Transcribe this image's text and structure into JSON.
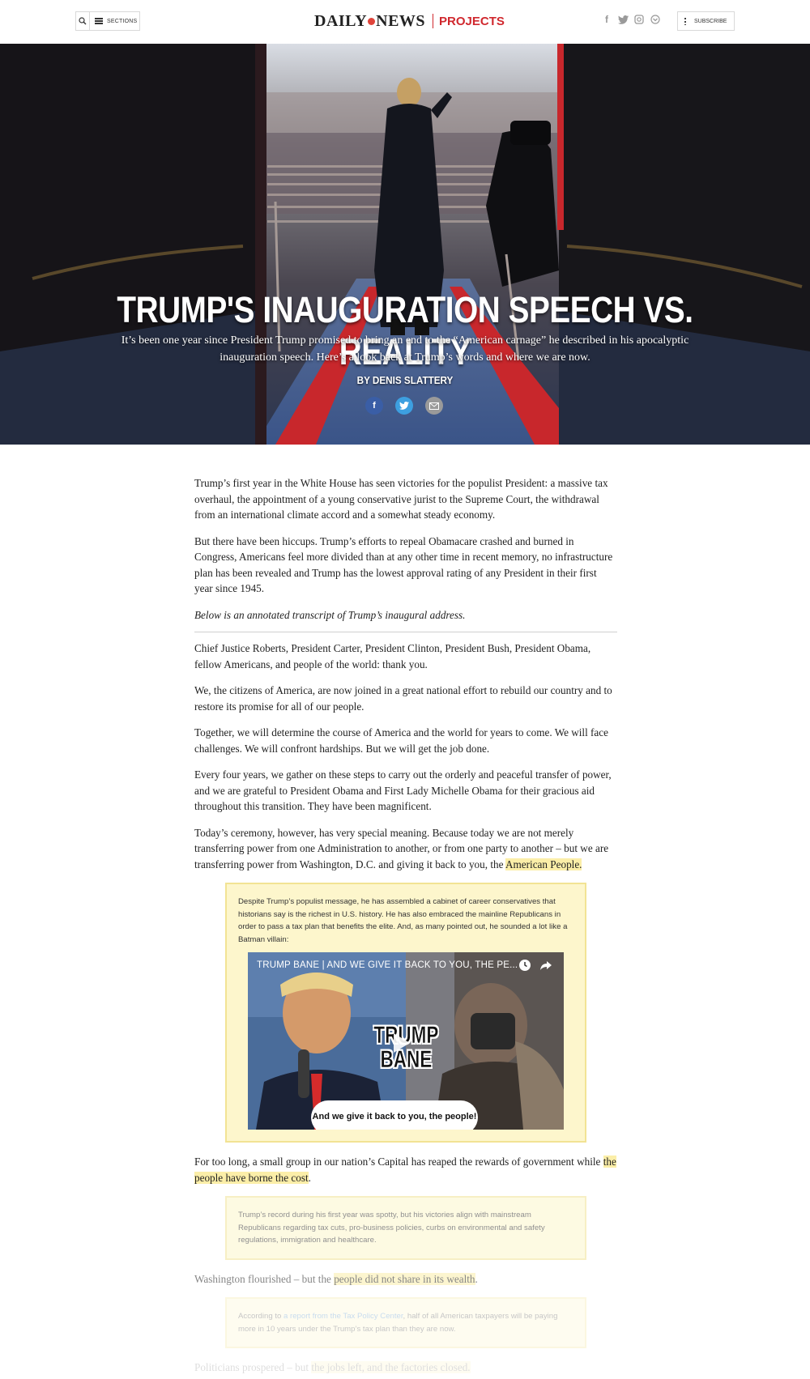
{
  "header": {
    "sections_label": "SECTIONS",
    "logo_left": "DAILY",
    "logo_right": "NEWS",
    "logo_projects": "PROJECTS",
    "subscribe_label": "SUBSCRIBE",
    "social": [
      "facebook-icon",
      "twitter-icon",
      "instagram-icon",
      "pocket-icon"
    ]
  },
  "hero": {
    "title": "TRUMP'S INAUGURATION SPEECH VS. REALITY",
    "subtitle": "It’s been one year since President Trump promised to bring an end to the “American carnage” he described in his apocalyptic inauguration speech. Here’s a look back at Trump’s words and where we are now.",
    "byline": "BY DENIS SLATTERY",
    "share": [
      "facebook-icon",
      "twitter-icon",
      "email-icon"
    ]
  },
  "article": {
    "intro": [
      "Trump’s first year in the White House has seen victories for the populist President: a massive tax overhaul, the appointment of a young conservative jurist to the Supreme Court, the withdrawal from an international climate accord and a somewhat steady economy.",
      "But there have been hiccups. Trump’s efforts to repeal Obamacare crashed and burned in Congress, Americans feel more divided than at any other time in recent memory, no infrastructure plan has been revealed and Trump has the lowest approval rating of any President in their first year since 1945."
    ],
    "transcript_note": "Below is an annotated transcript of Trump’s inaugural address.",
    "speech": [
      "Chief Justice Roberts, President Carter, President Clinton, President Bush, President Obama, fellow Americans, and people of the world: thank you.",
      "We, the citizens of America, are now joined in a great national effort to rebuild our country and to restore its promise for all of our people.",
      "Together, we will determine the course of America and the world for years to come. We will face challenges. We will confront hardships. But we will get the job done.",
      "Every four years, we gather on these steps to carry out the orderly and peaceful transfer of power, and we are grateful to President Obama and First Lady Michelle Obama for their gracious aid throughout this transition. They have been magnificent."
    ],
    "p5_text": "Today’s ceremony, however, has very special meaning. Because today we are not merely transferring power from one Administration to another, or from one party to another – but we are transferring power from Washington, D.C. and giving it back to you, the ",
    "p5_highlight": "American People.",
    "callout1": "Despite Trump’s populist message, he has assembled a cabinet of career conservatives that historians say is the richest in U.S. history. He has also embraced the mainline Republicans in order to pass a tax plan that benefits the elite. And, as many pointed out, he sounded a lot like a Batman villain:",
    "video_title": "TRUMP BANE | AND WE GIVE IT BACK TO YOU, THE PE...",
    "video_overlay_1": "TRUMP",
    "video_overlay_2": "BANE",
    "video_caption": "And we give it back to you, the people!",
    "p6_text": "For too long, a small group in our nation’s Capital has reaped the rewards of government while ",
    "p6_highlight": "the people have borne the cost",
    "p6_end": ".",
    "callout2": "Trump’s record during his first year was spotty, but his victories align with mainstream Republicans regarding tax cuts, pro-business policies, curbs on environmental and safety regulations, immigration and healthcare.",
    "p7_text": "Washington flourished – but the ",
    "p7_highlight": "people did not share in its wealth",
    "p7_end": ".",
    "callout3_a": "According to ",
    "callout3_link": "a report from the Tax Policy Center",
    "callout3_b": ", half of all American taxpayers will be paying more in 10 years under the Trump’s tax plan than they are now.",
    "p8_text": "Politicians prospered – but ",
    "p8_highlight": "the jobs left, and the factories closed."
  },
  "colors": {
    "brand_red": "#d0282e",
    "highlight": "#fbeea8",
    "callout_bg": "#fdf6cc"
  }
}
